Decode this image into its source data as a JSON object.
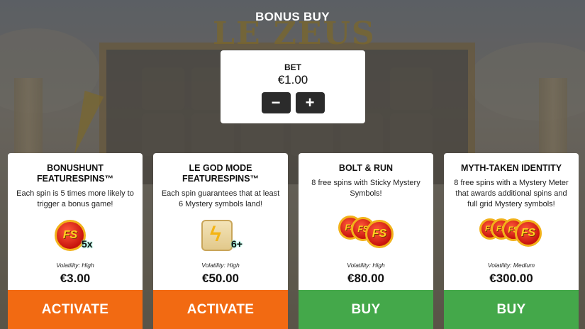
{
  "title": "BONUS BUY",
  "background": {
    "logo": "LE ZEUS"
  },
  "bet": {
    "label": "BET",
    "value": "€1.00",
    "minus_label": "−",
    "plus_label": "+"
  },
  "cards": [
    {
      "title": "BONUSHUNT FEATURESPINS™",
      "description": "Each spin is 5 times more likely to trigger a bonus game!",
      "icon": "fs-coin-icon",
      "multiplier": "5x",
      "volatility": "Volatility: High",
      "price": "€3.00",
      "action": "ACTIVATE",
      "action_color": "#f26a12"
    },
    {
      "title": "LE GOD MODE FEATURESPINS™",
      "description": "Each spin guarantees that at least 6 Mystery symbols land!",
      "icon": "lightning-scroll-icon",
      "multiplier": "6+",
      "volatility": "Volatility: High",
      "price": "€50.00",
      "action": "ACTIVATE",
      "action_color": "#f26a12"
    },
    {
      "title": "BOLT & RUN",
      "description": "8 free spins with Sticky Mystery Symbols!",
      "icon": "fs-coins-icon",
      "volatility": "Volatility: High",
      "price": "€80.00",
      "action": "BUY",
      "action_color": "#44a84a"
    },
    {
      "title": "MYTH-TAKEN IDENTITY",
      "description": "8 free spins with a Mystery Meter that awards additional spins and full grid Mystery symbols!",
      "icon": "fs-coins-stack-icon",
      "volatility": "Volatility: Medium",
      "price": "€300.00",
      "action": "BUY",
      "action_color": "#44a84a"
    }
  ],
  "coin_label": "FS"
}
